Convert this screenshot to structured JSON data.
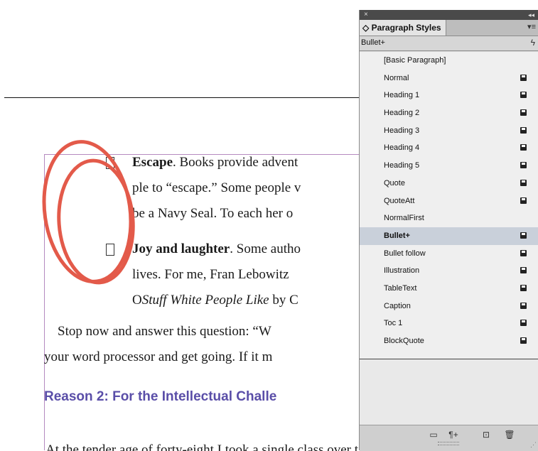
{
  "document": {
    "bullet1_term": "Escape",
    "bullet1_line1_rest": ". Books provide advent",
    "bullet1_line2": "ple to “escape.” Some people v",
    "bullet1_line3": "be a Navy Seal. To each her o",
    "bullet2_term": "Joy and laughter",
    "bullet2_line1_rest": ". Some autho",
    "bullet2_line2": "lives. For me, Fran Lebowitz",
    "bullet2_line3_pre": "O",
    "bullet2_line3_italic": "Stuff White People Like",
    "bullet2_line3_post": " by C",
    "para_line1": "Stop now and answer this question: “W",
    "para_line2": "your word processor and get going. If it m",
    "heading": "Reason 2: For the Intellectual Challe",
    "cut_line": "At the tender age of forty-eight I took a single class over the ed. I"
  },
  "panel": {
    "close_glyph": "×",
    "collapse_glyph": "◂◂",
    "tab_label": "◇ Paragraph Styles",
    "menu_glyph": "▾≡",
    "current_style": "Bullet+",
    "lightning_glyph": "ϟ",
    "styles": [
      {
        "label": "[Basic Paragraph]",
        "icon": false
      },
      {
        "label": "Normal",
        "icon": true
      },
      {
        "label": "Heading 1",
        "icon": true
      },
      {
        "label": "Heading 2",
        "icon": true
      },
      {
        "label": "Heading 3",
        "icon": true
      },
      {
        "label": "Heading 4",
        "icon": true
      },
      {
        "label": "Heading 5",
        "icon": true
      },
      {
        "label": "Quote",
        "icon": true
      },
      {
        "label": "QuoteAtt",
        "icon": true
      },
      {
        "label": "NormalFirst",
        "icon": false
      },
      {
        "label": "Bullet+",
        "icon": true,
        "selected": true
      },
      {
        "label": "Bullet follow",
        "icon": true
      },
      {
        "label": "Illustration",
        "icon": true
      },
      {
        "label": "TableText",
        "icon": true
      },
      {
        "label": "Caption",
        "icon": true
      },
      {
        "label": "Toc 1",
        "icon": true
      },
      {
        "label": "BlockQuote",
        "icon": true
      }
    ],
    "footer": {
      "folder_glyph": "▭",
      "clear_override_glyph": "¶+",
      "new_style_glyph": "⊡",
      "delete_glyph": "🗑",
      "resize_glyph": "⋰"
    }
  },
  "colors": {
    "heading": "#5a4ea8",
    "annotation_circle": "#e35a4a",
    "selected_row": "#c9d0da"
  }
}
